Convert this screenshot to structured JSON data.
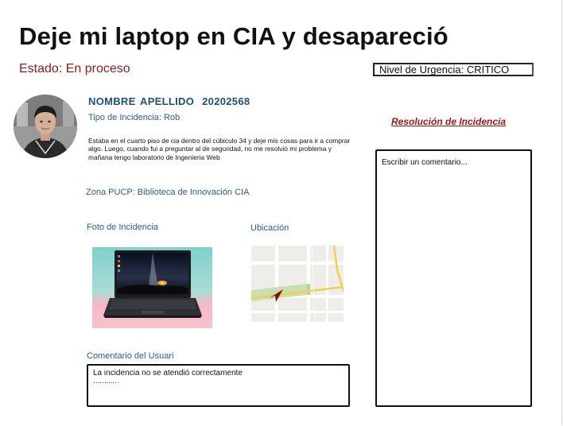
{
  "header": {
    "title": "Deje mi laptop en CIA y desapareció",
    "status": "Estado: En proceso",
    "urgency": "Nivel de Urgencia: CRITICO"
  },
  "user": {
    "name": "NOMBRE APELLIDO",
    "code": "20202568",
    "incident_type": "Tipo de Incidencia: Rob"
  },
  "incident": {
    "description": "Estaba en el cuarto piso de cia dentro del cúbiculo 34 y deje mis cosas para ir a comprar algo. Luego, cuando fui a preguntar al de seguridad, no me resolvió mi problema y mañana tengo laboratorio de Ingenieria Web",
    "zone": "Zona PUCP: Biblioteca de Innovación CIA",
    "photo_label": "Foto de Incidencia",
    "location_label": "Ubicación"
  },
  "user_comment": {
    "label": "Comentario del Usuari",
    "text": "La incidencia  no se atendió correctamente",
    "dots": "…………"
  },
  "resolution": {
    "title": "Resolución de Incidencia",
    "placeholder": "Escribir un comentario..."
  },
  "colors": {
    "status_red": "#8b1a1a",
    "label_blue": "#2a5d8f",
    "name_blue": "#1f4e79",
    "resolution_red": "#a31515"
  },
  "icons": {
    "map_pin": "location-arrow-icon"
  }
}
